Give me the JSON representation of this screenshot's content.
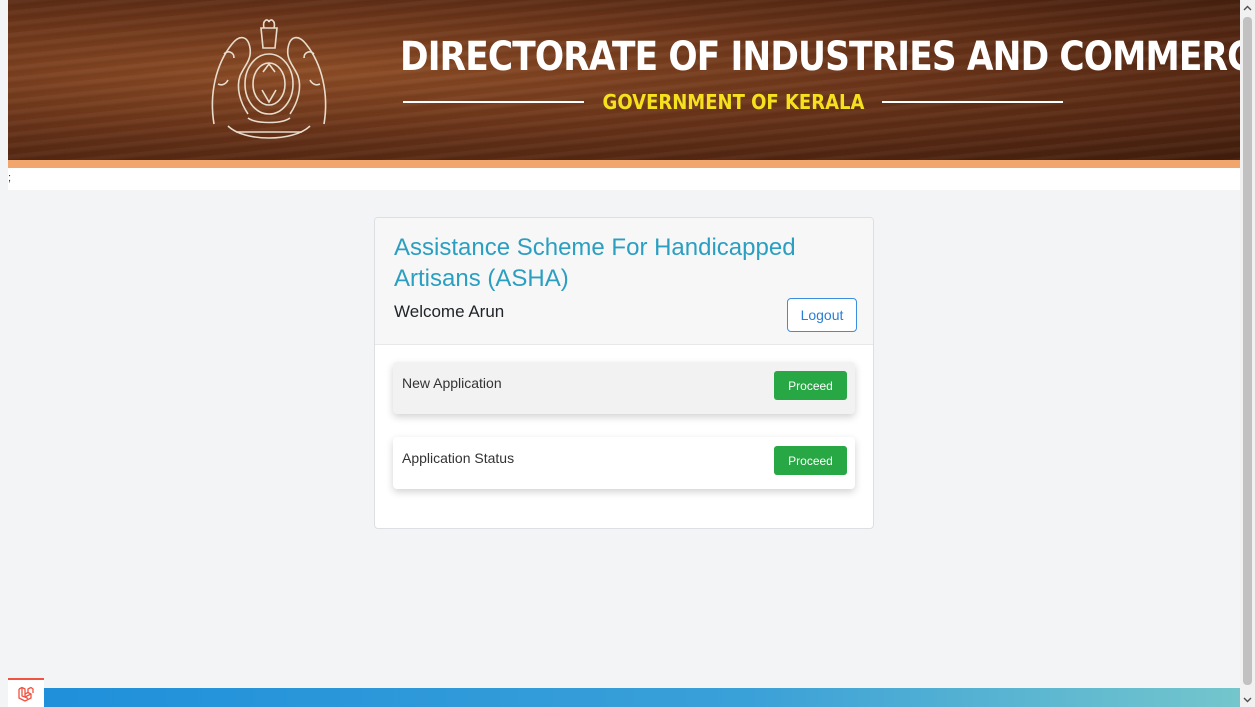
{
  "header": {
    "title": "DIRECTORATE OF INDUSTRIES AND COMMERCE",
    "subtitle": "GOVERNMENT OF KERALA",
    "stray_text": ";"
  },
  "card": {
    "title": "Assistance Scheme For Handicapped Artisans (ASHA)",
    "welcome": "Welcome Arun",
    "logout_label": "Logout",
    "options": [
      {
        "label": "New Application",
        "button_label": "Proceed"
      },
      {
        "label": "Application Status",
        "button_label": "Proceed"
      }
    ]
  },
  "colors": {
    "title_blue": "#2b9fc1",
    "proceed_green": "#28a745",
    "logout_blue": "#2a7ed6",
    "subtitle_yellow": "#f5e11c",
    "accent_strip": "#f0a66d"
  },
  "icons": {
    "emblem": "kerala-state-emblem-icon",
    "footer_badge": "laravel-logo-icon"
  }
}
